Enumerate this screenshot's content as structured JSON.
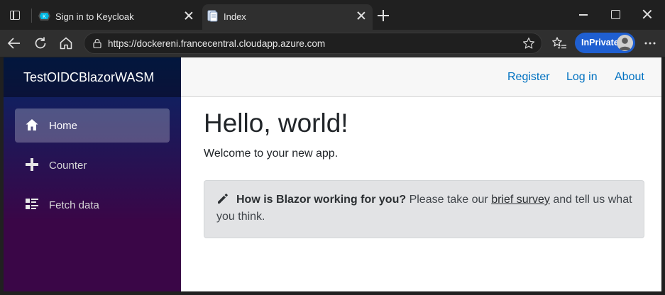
{
  "browser": {
    "tabs": [
      {
        "title": "Sign in to Keycloak",
        "active": false
      },
      {
        "title": "Index",
        "active": true
      }
    ],
    "url": "https://dockereni.francecentral.cloudapp.azure.com",
    "inprivate_label": "InPrivate",
    "accent_color": "#1f5fd1"
  },
  "app": {
    "brand": "TestOIDCBlazorWASM",
    "nav": [
      {
        "label": "Home",
        "icon": "home-icon",
        "active": true
      },
      {
        "label": "Counter",
        "icon": "plus-icon",
        "active": false
      },
      {
        "label": "Fetch data",
        "icon": "list-rich-icon",
        "active": false
      }
    ],
    "top_links": [
      "Register",
      "Log in",
      "About"
    ],
    "link_color": "#0071c1"
  },
  "main": {
    "heading": "Hello, world!",
    "lead": "Welcome to your new app.",
    "survey": {
      "bold": "How is Blazor working for you?",
      "pre": " Please take our ",
      "link": "brief survey",
      "post": " and tell us what you think."
    }
  }
}
